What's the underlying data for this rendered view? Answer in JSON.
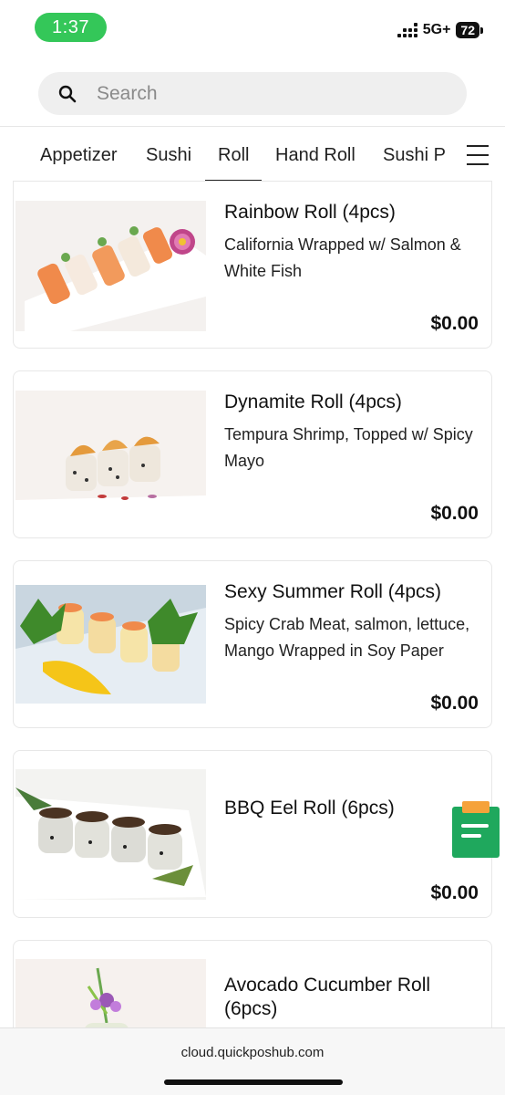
{
  "status_bar": {
    "time": "1:37",
    "network": "5G+",
    "battery": "72"
  },
  "search": {
    "placeholder": "Search",
    "value": ""
  },
  "tabs": [
    {
      "label": "Appetizer",
      "active": false
    },
    {
      "label": "Sushi",
      "active": false
    },
    {
      "label": "Roll",
      "active": true
    },
    {
      "label": "Hand Roll",
      "active": false
    },
    {
      "label": "Sushi P",
      "active": false
    }
  ],
  "items": [
    {
      "title": "Rainbow Roll (4pcs)",
      "description": "California Wrapped w/ Salmon & White Fish",
      "price": "$0.00"
    },
    {
      "title": "Dynamite Roll (4pcs)",
      "description": "Tempura Shrimp, Topped w/ Spicy Mayo",
      "price": "$0.00"
    },
    {
      "title": "Sexy Summer Roll (4pcs)",
      "description": "Spicy Crab Meat, salmon, lettuce, Mango Wrapped in Soy Paper",
      "price": "$0.00"
    },
    {
      "title": "BBQ Eel Roll (6pcs)",
      "description": "",
      "price": "$0.00"
    },
    {
      "title": "Avocado Cucumber Roll (6pcs)",
      "description": "",
      "price": ""
    }
  ],
  "url_bar": {
    "url": "cloud.quickposhub.com"
  },
  "colors": {
    "time_pill": "#34c759",
    "cart_green": "#1fa85d",
    "cart_orange": "#f5a23a"
  }
}
